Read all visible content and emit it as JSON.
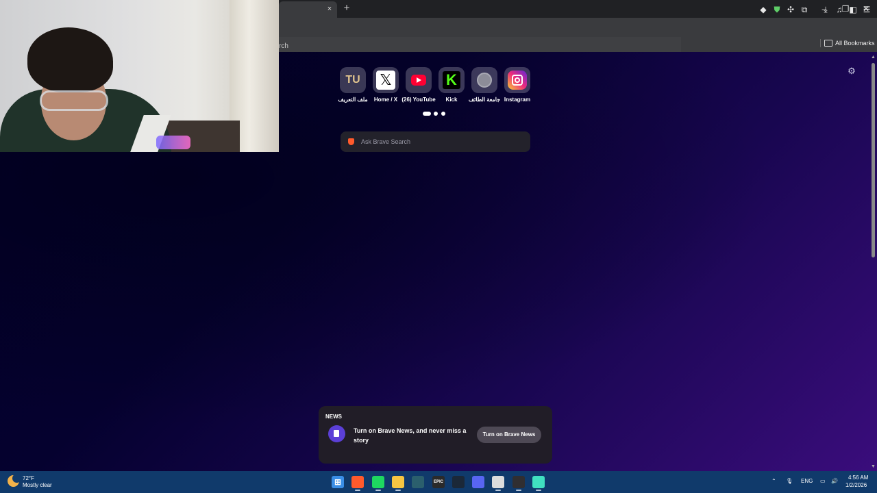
{
  "browser": {
    "tab_close_glyph": "×",
    "new_tab_glyph": "+",
    "window_controls": {
      "minimize": "–",
      "restore": "❐",
      "close": "✕"
    },
    "dropdown_text": "rch",
    "bookmarks_label": "All Bookmarks"
  },
  "newtab": {
    "top_sites": [
      {
        "label": "ملف التعريف",
        "icon": "tu-icon",
        "glyph": "TU"
      },
      {
        "label": "Home / X",
        "icon": "x-icon",
        "glyph": "𝕏"
      },
      {
        "label": "(26) YouTube",
        "icon": "youtube-icon",
        "glyph": ""
      },
      {
        "label": "Kick",
        "icon": "kick-icon",
        "glyph": "K"
      },
      {
        "label": "جامعة الطائف",
        "icon": "globe-icon",
        "glyph": ""
      },
      {
        "label": "Instagram",
        "icon": "instagram-icon",
        "glyph": ""
      }
    ],
    "search_placeholder": "Ask Brave Search",
    "news": {
      "heading": "NEWS",
      "text": "Turn on Brave News, and never miss a story",
      "button": "Turn on Brave News"
    },
    "settings_glyph": "⚙"
  },
  "taskbar": {
    "weather_temp": "72°F",
    "weather_desc": "Mostly clear",
    "language": "ENG",
    "time": "4:56 AM",
    "date": "1/2/2026",
    "apps": [
      {
        "name": "start-button",
        "glyph": "⊞",
        "color": "#3a8ee6"
      },
      {
        "name": "brave-taskbar-icon",
        "glyph": "",
        "color": "#ff5a2c"
      },
      {
        "name": "spotify-taskbar-icon",
        "glyph": "",
        "color": "#1ed760"
      },
      {
        "name": "file-explorer-taskbar-icon",
        "glyph": "",
        "color": "#f5c542"
      },
      {
        "name": "davinci-taskbar-icon",
        "glyph": "",
        "color": "#2b5f6d"
      },
      {
        "name": "epic-games-taskbar-icon",
        "glyph": "EPIC",
        "color": "#2a2a2a"
      },
      {
        "name": "steam-taskbar-icon",
        "glyph": "",
        "color": "#1b2838"
      },
      {
        "name": "discord-taskbar-icon",
        "glyph": "",
        "color": "#5865f2"
      },
      {
        "name": "steelseries-taskbar-icon",
        "glyph": "",
        "color": "#dcdcdc"
      },
      {
        "name": "obs-taskbar-icon",
        "glyph": "",
        "color": "#302e31"
      },
      {
        "name": "app-taskbar-icon",
        "glyph": "",
        "color": "#40e0c0"
      }
    ]
  }
}
